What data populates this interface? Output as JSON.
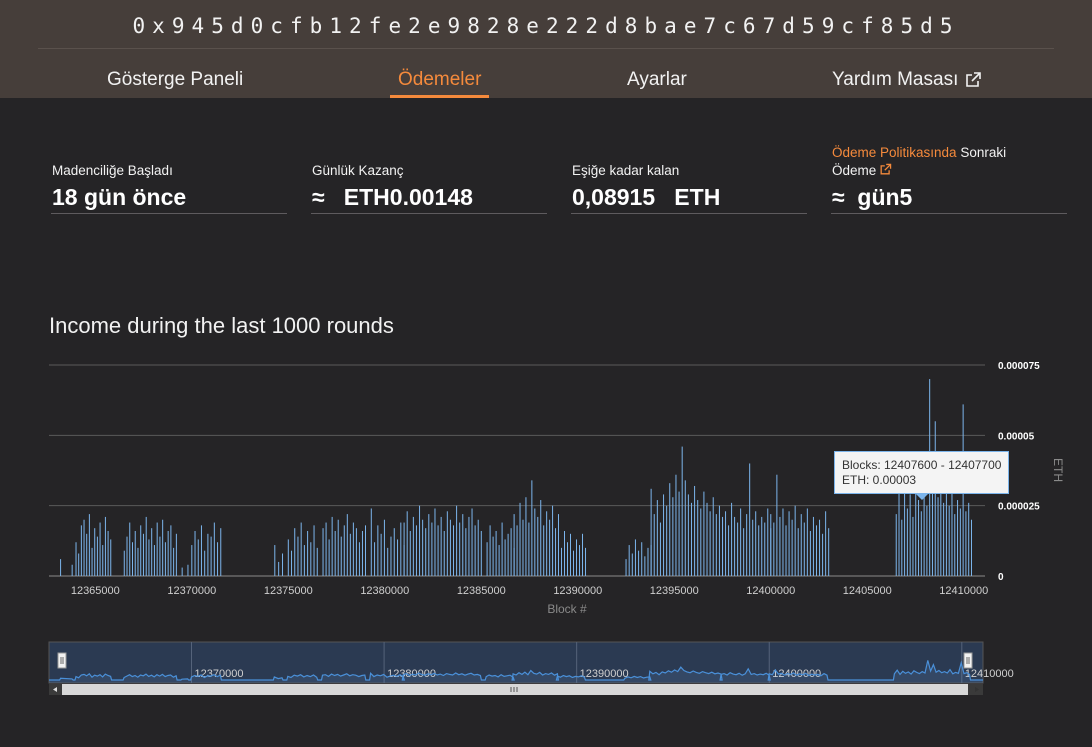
{
  "header": {
    "address": "0x945d0cfb12fe2e9828e222d8bae7c67d59cf85d5",
    "nav": [
      {
        "label": "Gösterge Paneli",
        "active": false
      },
      {
        "label": "Ödemeler",
        "active": true
      },
      {
        "label": "Ayarlar",
        "active": false
      },
      {
        "label": "Yardım Masası",
        "active": false,
        "icon": "external-link-icon"
      }
    ]
  },
  "stats": {
    "mining_started": {
      "label": "Madenciliğe Başladı",
      "value": "18 gün önce"
    },
    "daily_earnings": {
      "label": "Günlük Kazanç",
      "value": "≈   ETH0.00148"
    },
    "remaining": {
      "label": "Eşiğe kadar kalan",
      "value": "0,08915   ETH"
    },
    "next_payout": {
      "label_link": "Ödeme Politikasında",
      "label_rest": " Sonraki",
      "label_line2": "Ödeme",
      "value": "≈  gün5",
      "icon": "external-link-icon"
    }
  },
  "chart": {
    "title": "Income during the last 1000 rounds",
    "tooltip": {
      "line1": "Blocks: 12407600 - 12407700",
      "line2": "ETH: 0.00003"
    }
  },
  "navigator": {
    "labels": [
      "12370000",
      "12380000",
      "12390000",
      "12400000",
      "12410000"
    ]
  },
  "colors": {
    "accent": "#f58a3c",
    "series": "#7cb5ec",
    "header_bg": "#463e3a",
    "page_bg": "#252426"
  },
  "chart_data": {
    "type": "bar",
    "title": "Income during the last 1000 rounds",
    "xlabel": "Block #",
    "ylabel": "ETH",
    "xlim": [
      12362600,
      12411100
    ],
    "ylim": [
      0,
      7.5e-05
    ],
    "xticks": [
      12365000,
      12370000,
      12375000,
      12380000,
      12385000,
      12390000,
      12395000,
      12400000,
      12405000,
      12410000
    ],
    "yticks": [
      {
        "v": 0,
        "label": "0"
      },
      {
        "v": 2.5e-05,
        "label": "0.000025"
      },
      {
        "v": 5e-05,
        "label": "0.00005"
      },
      {
        "v": 7.5e-05,
        "label": "0.000075"
      }
    ],
    "grid": true,
    "bar_width_blocks": 50,
    "series": [
      {
        "color": "#7cb5ec",
        "segments": [
          {
            "start": 12363200,
            "end": 12363800,
            "values": [
              6e-06,
              4e-06
            ]
          },
          {
            "start": 12364000,
            "end": 12365800,
            "values": [
              1.2e-05,
              8e-06,
              1.8e-05,
              2e-05,
              1.5e-05,
              2.2e-05,
              1e-05,
              1.7e-05,
              1.4e-05,
              1.9e-05,
              1.1e-05,
              2.1e-05,
              1.6e-05,
              1.3e-05
            ]
          },
          {
            "start": 12366500,
            "end": 12369200,
            "values": [
              9e-06,
              1.4e-05,
              1.9e-05,
              1.2e-05,
              1.6e-05,
              1e-05,
              1.8e-05,
              1.5e-05,
              2.1e-05,
              1.3e-05,
              1.7e-05,
              1.1e-05,
              1.9e-05,
              1.4e-05,
              2e-05,
              1.2e-05,
              1.6e-05,
              1.8e-05,
              1e-05,
              1.5e-05
            ]
          },
          {
            "start": 12369500,
            "end": 12369800,
            "values": [
              3e-06,
              4e-06
            ]
          },
          {
            "start": 12370000,
            "end": 12371500,
            "values": [
              1.1e-05,
              1.6e-05,
              1.3e-05,
              1.8e-05,
              9e-06,
              1.5e-05,
              1.4e-05,
              1.9e-05,
              1.2e-05,
              1.7e-05
            ]
          },
          {
            "start": 12374300,
            "end": 12374700,
            "values": [
              1.1e-05,
              5e-06,
              8e-06
            ]
          },
          {
            "start": 12375000,
            "end": 12376500,
            "values": [
              1.3e-05,
              9e-06,
              1.7e-05,
              1.4e-05,
              1.9e-05,
              1.1e-05,
              1.6e-05,
              1.2e-05,
              1.8e-05,
              1e-05
            ]
          },
          {
            "start": 12376800,
            "end": 12379000,
            "values": [
              1.7e-05,
              1.9e-05,
              1.3e-05,
              2.1e-05,
              1.6e-05,
              2e-05,
              1.4e-05,
              1.8e-05,
              2.2e-05,
              1.5e-05,
              1.9e-05,
              1.7e-05,
              1.2e-05,
              1.6e-05,
              1.8e-05
            ]
          },
          {
            "start": 12379300,
            "end": 12381000,
            "values": [
              2.4e-05,
              1.2e-05,
              1.8e-05,
              1.5e-05,
              2e-05,
              1e-05,
              1.4e-05,
              1.7e-05,
              1.3e-05,
              1.9e-05,
              1.1e-05
            ]
          },
          {
            "start": 12381000,
            "end": 12385000,
            "values": [
              1.9e-05,
              2.3e-05,
              1.6e-05,
              2.1e-05,
              1.8e-05,
              2.5e-05,
              2e-05,
              1.7e-05,
              2.2e-05,
              1.9e-05,
              2.4e-05,
              1.8e-05,
              2.1e-05,
              1.6e-05,
              2.3e-05,
              2e-05,
              1.8e-05,
              2.5e-05,
              1.9e-05,
              2.2e-05,
              1.7e-05,
              2.1e-05,
              2.4e-05,
              1.8e-05,
              2e-05,
              1.6e-05
            ]
          },
          {
            "start": 12385300,
            "end": 12386700,
            "values": [
              1.2e-05,
              1.8e-05,
              1.4e-05,
              1.6e-05,
              1.1e-05,
              1.9e-05,
              1.3e-05,
              1.5e-05,
              1.7e-05,
              1e-05
            ]
          },
          {
            "start": 12386700,
            "end": 12389000,
            "values": [
              2.2e-05,
              1.8e-05,
              2.6e-05,
              2e-05,
              2.8e-05,
              1.9e-05,
              3.4e-05,
              2.4e-05,
              2.1e-05,
              2.7e-05,
              1.8e-05,
              2.3e-05,
              2e-05,
              2.5e-05,
              1.7e-05,
              2.2e-05
            ]
          },
          {
            "start": 12389000,
            "end": 12390400,
            "values": [
              1.4e-05,
              1e-05,
              1.6e-05,
              1.2e-05,
              1.5e-05,
              9e-06,
              1.3e-05,
              1.1e-05,
              1.5e-05,
              1e-05
            ]
          },
          {
            "start": 12392500,
            "end": 12393800,
            "values": [
              6e-06,
              1.1e-05,
              8e-06,
              1.3e-05,
              9e-06,
              1.2e-05,
              7e-06,
              1e-05,
              1.1e-05
            ]
          },
          {
            "start": 12393800,
            "end": 12397500,
            "values": [
              3.1e-05,
              2.2e-05,
              2.7e-05,
              1.9e-05,
              2.9e-05,
              2.5e-05,
              3.3e-05,
              2.8e-05,
              3.6e-05,
              3e-05,
              4.6e-05,
              3.4e-05,
              2.9e-05,
              2.6e-05,
              3.2e-05,
              2.7e-05,
              2.4e-05,
              3e-05,
              2.6e-05,
              2.3e-05,
              2.8e-05,
              2.2e-05,
              2.5e-05,
              2.1e-05
            ]
          },
          {
            "start": 12397500,
            "end": 12400000,
            "values": [
              2e-05,
              2.3e-05,
              1.8e-05,
              2.6e-05,
              2.1e-05,
              1.9e-05,
              2.4e-05,
              1.7e-05,
              2.2e-05,
              4e-05,
              2e-05,
              2.3e-05,
              1.8e-05,
              2.1e-05,
              1.9e-05,
              2.4e-05,
              1.7e-05
            ]
          },
          {
            "start": 12400000,
            "end": 12403000,
            "values": [
              2.2e-05,
              1.9e-05,
              3.6e-05,
              2.1e-05,
              2.4e-05,
              1.8e-05,
              2.3e-05,
              2e-05,
              2.5e-05,
              1.7e-05,
              2.2e-05,
              1.9e-05,
              2.4e-05,
              1.6e-05,
              2.1e-05,
              1.8e-05,
              2e-05,
              1.5e-05,
              2.3e-05,
              1.7e-05
            ]
          },
          {
            "start": 12406500,
            "end": 12410400,
            "values": [
              2.2e-05,
              3.5e-05,
              2e-05,
              3.1e-05,
              2.4e-05,
              2.9e-05,
              2.1e-05,
              3.3e-05,
              2.7e-05,
              2.3e-05,
              3e-05,
              2.5e-05,
              7e-05,
              3.2e-05,
              5.5e-05,
              2.8e-05,
              3.4e-05,
              2.6e-05,
              3e-05,
              2.5e-05,
              3.7e-05,
              2.2e-05,
              2.7e-05,
              2.4e-05,
              6.1e-05,
              2.3e-05,
              2.6e-05,
              2e-05
            ]
          }
        ]
      }
    ]
  }
}
